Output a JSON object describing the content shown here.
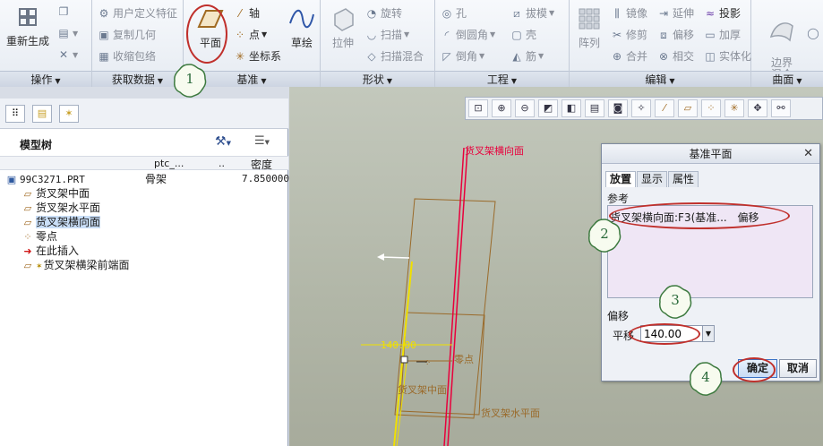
{
  "ribbon": {
    "groups": {
      "operations": {
        "label": "操作"
      },
      "get_data": {
        "label": "获取数据"
      },
      "datum": {
        "label": "基准"
      },
      "shape": {
        "label": "形状"
      },
      "engineering": {
        "label": "工程"
      },
      "edit": {
        "label": "编辑"
      },
      "surface": {
        "label": "曲面"
      }
    },
    "regenerate": "重新生成",
    "udf": "用户定义特征",
    "copy_geometry": "复制几何",
    "shrinkwrap": "收缩包络",
    "plane": "平面",
    "axis": "轴",
    "point": "点",
    "coordinate_system": "坐标系",
    "sketch": "草绘",
    "extrude": "拉伸",
    "revolve": "旋转",
    "sweep": "扫描",
    "swept_blend": "扫描混合",
    "hole": "孔",
    "round": "倒圆角",
    "chamfer": "倒角",
    "draft": "拔模",
    "shell": "壳",
    "rib": "筋",
    "pattern": "阵列",
    "mirror": "镜像",
    "trim": "修剪",
    "merge": "合并",
    "extend": "延伸",
    "offset": "偏移",
    "intersect": "相交",
    "project": "投影",
    "thicken": "加厚",
    "solidify": "实体化",
    "boundary_blend": "边界\n混合"
  },
  "left_panel": {
    "title": "模型树",
    "columns": {
      "name": "",
      "ptc": "ptc_...",
      "dots": "..",
      "density": "密度"
    },
    "root": {
      "name": "99C3271.PRT",
      "ptc": "骨架",
      "density": "7.850000"
    },
    "items": [
      {
        "icon": "datum-plane-icon",
        "label": "货叉架中面"
      },
      {
        "icon": "datum-plane-icon",
        "label": "货叉架水平面"
      },
      {
        "icon": "datum-plane-icon",
        "label": "货叉架横向面"
      },
      {
        "icon": "datum-point-icon",
        "label": "零点"
      },
      {
        "icon": "insert-here-icon",
        "label": "在此插入"
      },
      {
        "icon": "datum-plane-icon",
        "label": "货叉架横梁前端面"
      }
    ]
  },
  "scene": {
    "plane_top_label": "货叉架横向面",
    "offset_value": "140.00",
    "zero_point": "零点",
    "mid_plane": "货叉架中面",
    "horiz_plane": "货叉架水平面"
  },
  "dialog": {
    "title": "基准平面",
    "tabs": [
      "放置",
      "显示",
      "属性"
    ],
    "references_label": "参考",
    "reference_item": "货叉架横向面:F3(基准...",
    "reference_constraint": "偏移",
    "offset_label": "偏移",
    "translation_label": "平移",
    "translation_value": "140.00",
    "ok": "确定",
    "cancel": "取消"
  },
  "callouts": [
    "1",
    "2",
    "3",
    "4"
  ],
  "colors": {
    "callout_ring": "#c0302c",
    "datum": "#9a6a2a",
    "selected_plane": "#e8003c",
    "preview": "#f0e000"
  }
}
